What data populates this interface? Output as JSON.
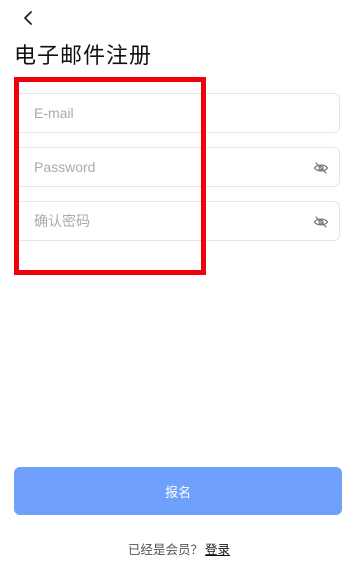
{
  "header": {
    "back_icon": "chevron-left-icon",
    "title": "电子邮件注册"
  },
  "form": {
    "email": {
      "value": "",
      "placeholder": "E-mail"
    },
    "password": {
      "value": "",
      "placeholder": "Password",
      "toggle_icon": "eye-off-icon"
    },
    "confirm_password": {
      "value": "",
      "placeholder": "确认密码",
      "toggle_icon": "eye-off-icon"
    }
  },
  "annotation": {
    "color": "#f0000b"
  },
  "submit": {
    "label": "报名",
    "color": "#6fa0fb"
  },
  "footer": {
    "prompt": "已经是会员？",
    "login_link": "登录"
  }
}
